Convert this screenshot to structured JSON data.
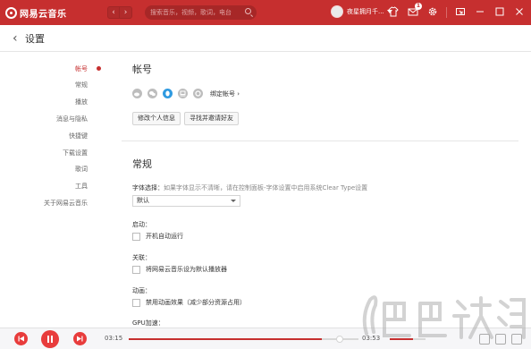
{
  "app": {
    "name": "网易云音乐"
  },
  "topbar": {
    "back_glyph": "‹",
    "forward_glyph": "›",
    "search_placeholder": "搜索音乐，视频，歌词，电台",
    "username": "夜星拥月千...",
    "message_count": "1",
    "icons": [
      "skin-icon",
      "mail-icon",
      "settings-icon",
      "mini-mode-icon",
      "minimize-icon",
      "maximize-icon",
      "close-icon"
    ]
  },
  "header": {
    "back_glyph": "‹",
    "title": "设置"
  },
  "sidebar": {
    "items": [
      {
        "label": "帐号",
        "active": true
      },
      {
        "label": "常规",
        "active": false
      },
      {
        "label": "播放",
        "active": false
      },
      {
        "label": "消息与隐私",
        "active": false
      },
      {
        "label": "快捷键",
        "active": false
      },
      {
        "label": "下载设置",
        "active": false
      },
      {
        "label": "歌词",
        "active": false
      },
      {
        "label": "工具",
        "active": false
      },
      {
        "label": "关于网易云音乐",
        "active": false
      }
    ]
  },
  "account": {
    "title": "帐号",
    "social_icons": [
      "weibo-icon",
      "wechat-icon",
      "qq-icon",
      "douban-icon",
      "netease-icon"
    ],
    "bind_label": "绑定帐号",
    "bind_arrow": "›",
    "edit_profile_button": "修改个人信息",
    "find_friends_button": "寻找并邀请好友"
  },
  "general": {
    "title": "常规",
    "font_label": "字体选择：",
    "font_hint": "如果字体显示不清晰，请在控制面板-字体设置中启用系统Clear Type设置",
    "font_value": "默认",
    "startup_label": "启动：",
    "startup_option": "开机自动运行",
    "association_label": "关联：",
    "association_option": "将网易云音乐设为默认播放器",
    "animation_label": "动画：",
    "animation_option": "禁用动画效果（减少部分资源占用）",
    "gpu_label": "GPU加速："
  },
  "player": {
    "current_time": "03:15",
    "total_time": "03:53",
    "progress": 0.84,
    "volume": 0.65,
    "icons": [
      "play-mode-icon",
      "lyrics-icon",
      "playlist-icon"
    ]
  },
  "colors": {
    "brand": "#c62f2f",
    "accent": "#e83c3c"
  }
}
